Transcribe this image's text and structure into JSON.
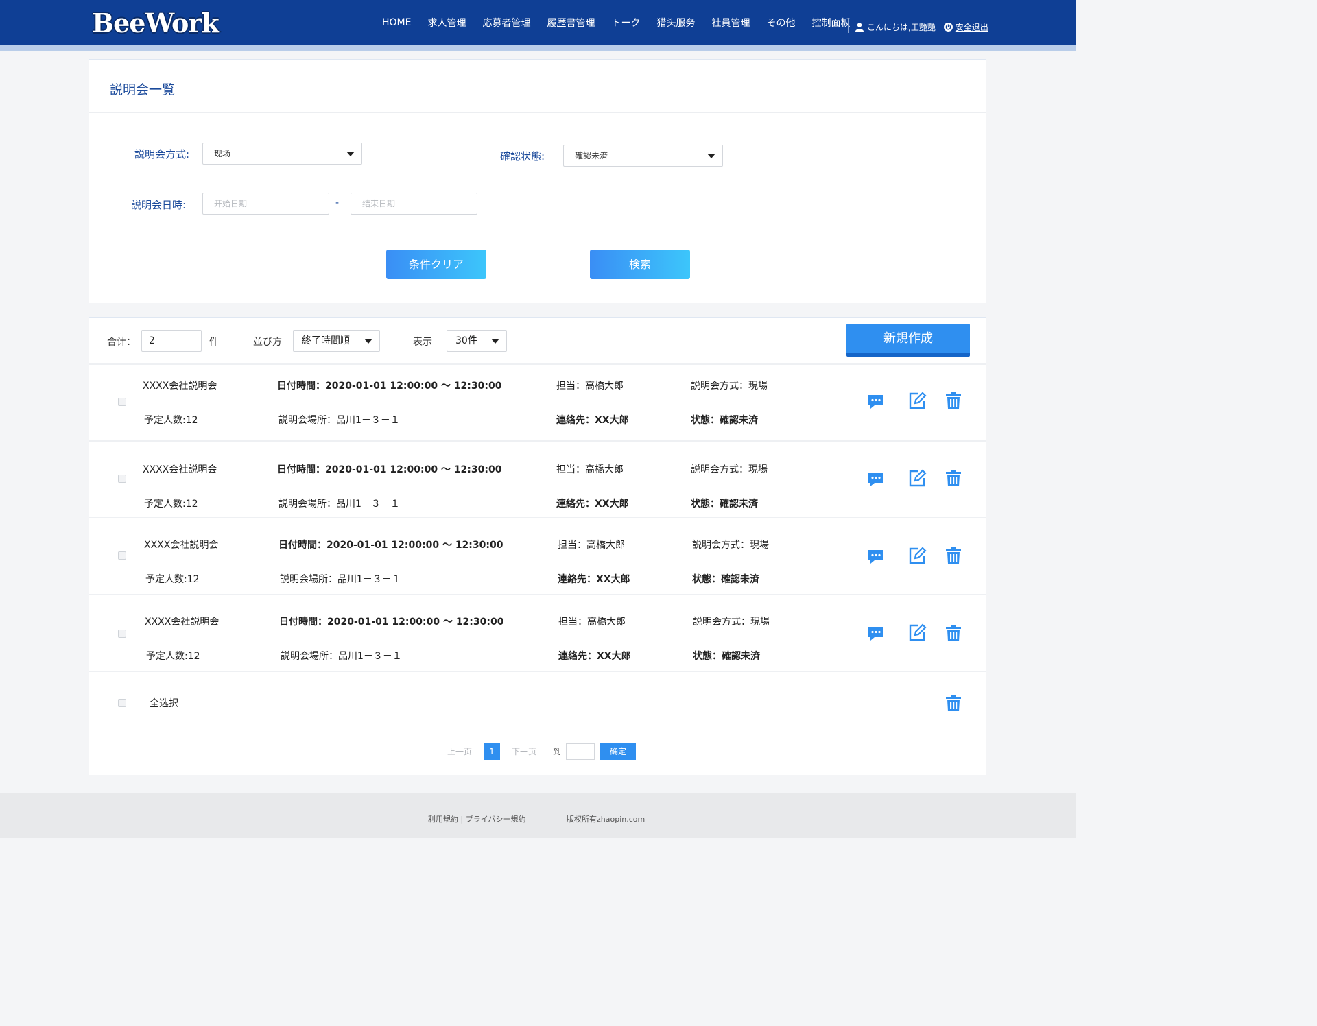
{
  "header": {
    "logo_text": "BeeWork",
    "nav": [
      "HOME",
      "求人管理",
      "応募者管理",
      "履歴書管理",
      "トーク",
      "猎头服务",
      "社員管理",
      "その他",
      "控制面板"
    ],
    "greeting": "こんにちは,王艷艷",
    "logout": "安全退出"
  },
  "search": {
    "title": "説明会一覧",
    "method_label": "説明会方式:",
    "method_value": "现场",
    "status_label": "確認状態:",
    "status_value": "確認未済",
    "date_label": "説明会日時:",
    "start_placeholder": "开始日期",
    "end_placeholder": "结束日期",
    "date_dash": "-",
    "clear_button": "条件クリア",
    "search_button": "検索"
  },
  "toolbar": {
    "total_label": "合计：",
    "total_value": "2",
    "total_unit": "件",
    "sort_label": "並び方",
    "sort_value": "終了時間順",
    "display_label": "表示",
    "display_value": "30件",
    "new_button": "新規作成"
  },
  "rows": [
    {
      "name": "XXXX会社説明会",
      "planned": "予定人数:12",
      "datetime": "日付時間：2020-01-01 12:00:00 ～ 12:30:00",
      "place": "説明会場所：品川1－３－１",
      "owner": "担当：高橋大郎",
      "contact": "連絡先：XX大郎",
      "method": "説明会方式：現場",
      "status": "状態：確認未済"
    },
    {
      "name": "XXXX会社説明会",
      "planned": "予定人数:12",
      "datetime": "日付時間：2020-01-01 12:00:00 ～ 12:30:00",
      "place": "説明会場所：品川1－３－１",
      "owner": "担当：高橋大郎",
      "contact": "連絡先：XX大郎",
      "method": "説明会方式：現場",
      "status": "状態：確認未済"
    },
    {
      "name": "XXXX会社説明会",
      "planned": "予定人数:12",
      "datetime": "日付時間：2020-01-01 12:00:00 ～ 12:30:00",
      "place": "説明会場所：品川1－３－１",
      "owner": "担当：高橋大郎",
      "contact": "連絡先：XX大郎",
      "method": "説明会方式：現場",
      "status": "状態：確認未済"
    },
    {
      "name": "XXXX会社説明会",
      "planned": "予定人数:12",
      "datetime": "日付時間：2020-01-01 12:00:00 ～ 12:30:00",
      "place": "説明会場所：品川1－３－１",
      "owner": "担当：高橋大郎",
      "contact": "連絡先：XX大郎",
      "method": "説明会方式：現場",
      "status": "状態：確認未済"
    }
  ],
  "select_all": "全选択",
  "pagination": {
    "prev": "上一页",
    "current": "1",
    "next": "下一页",
    "goto": "到",
    "confirm": "确定"
  },
  "footer": {
    "links": "利用規約 | プライバシー規約",
    "copyright": "版权所有zhaopin.com"
  },
  "colors": {
    "header": "#0f3f95",
    "accent": "#2f8ff0",
    "label": "#1b4a9b"
  }
}
